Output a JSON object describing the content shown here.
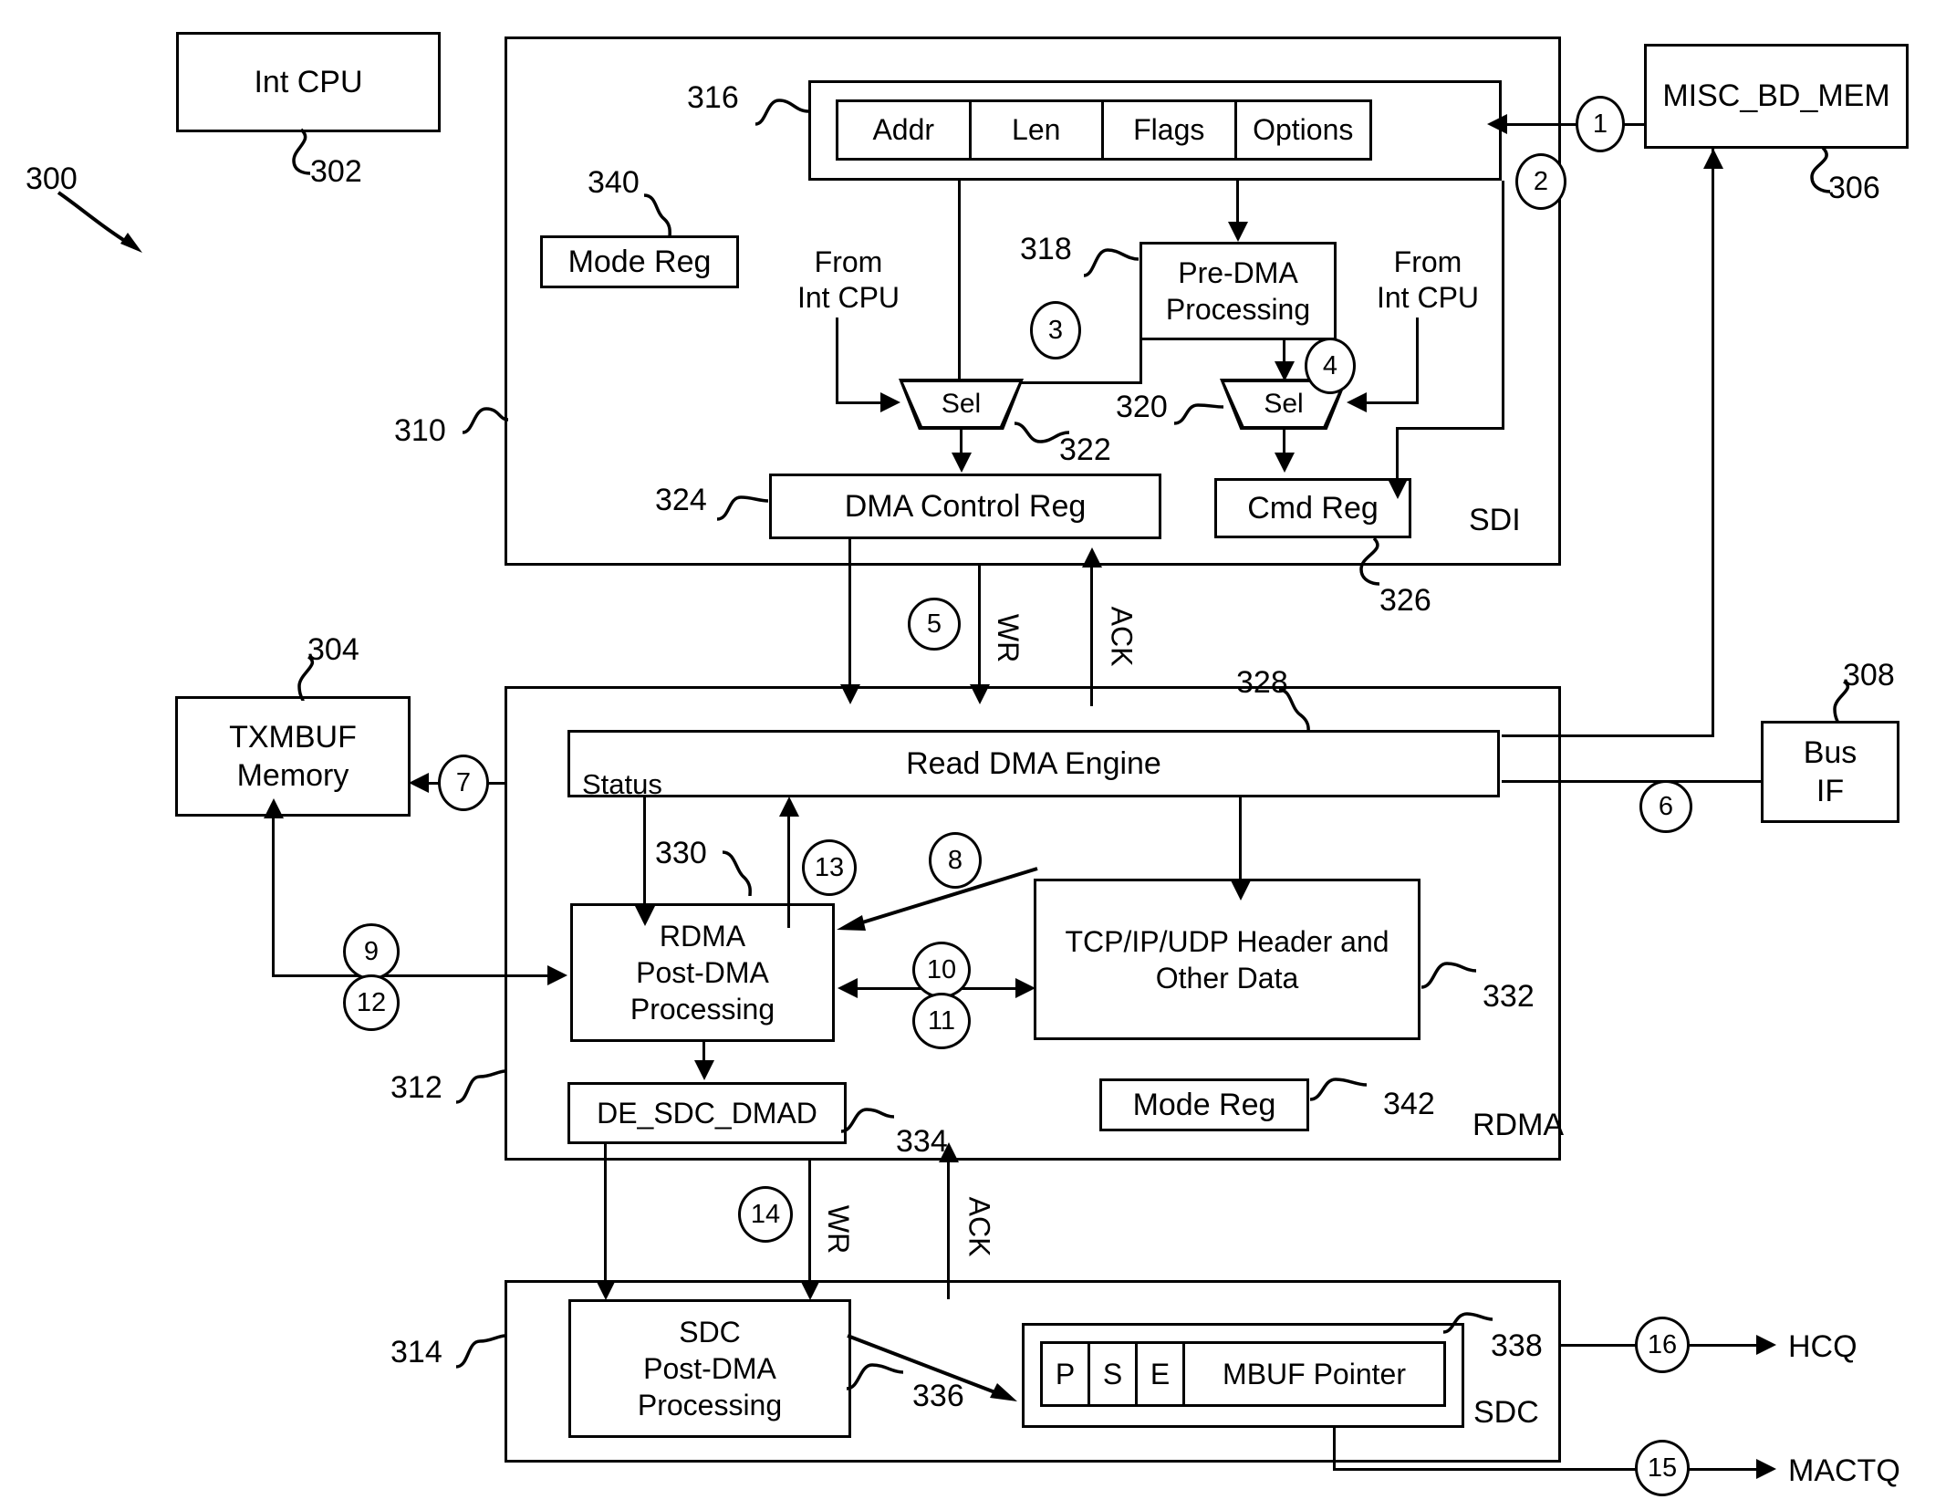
{
  "figure": {
    "number": "300"
  },
  "blocks": {
    "int_cpu": "Int CPU",
    "misc_bd_mem": "MISC_BD_MEM",
    "txmbuf_memory": "TXMBUF\nMemory",
    "txmbuf_line1": "TXMBUF",
    "txmbuf_line2": "Memory",
    "bus_if_line1": "Bus",
    "bus_if_line2": "IF",
    "mode_reg_sdi": "Mode Reg",
    "mode_reg_rdma": "Mode Reg",
    "pre_dma_line1": "Pre-DMA",
    "pre_dma_line2": "Processing",
    "dma_control_reg": "DMA Control Reg",
    "cmd_reg": "Cmd Reg",
    "sel_left": "Sel",
    "sel_right": "Sel",
    "read_dma_engine": "Read DMA Engine",
    "status": "Status",
    "rdma_post_dma_l1": "RDMA",
    "rdma_post_dma_l2": "Post-DMA",
    "rdma_post_dma_l3": "Processing",
    "tcp_header_l1": "TCP/IP/UDP Header and",
    "tcp_header_l2": "Other Data",
    "de_sdc_dmad": "DE_SDC_DMAD",
    "sdc_post_dma_l1": "SDC",
    "sdc_post_dma_l2": "Post-DMA",
    "sdc_post_dma_l3": "Processing",
    "mbuf_pointer": "MBUF Pointer",
    "mbuf_p": "P",
    "mbuf_s": "S",
    "mbuf_e": "E"
  },
  "bd_fields": [
    "Addr",
    "Len",
    "Flags",
    "Options"
  ],
  "container_labels": {
    "sdi": "SDI",
    "rdma": "RDMA",
    "sdc": "SDC"
  },
  "from_labels": {
    "from_int_cpu_left_l1": "From",
    "from_int_cpu_left_l2": "Int CPU",
    "from_int_cpu_right_l1": "From",
    "from_int_cpu_right_l2": "Int CPU"
  },
  "signal_labels": {
    "wr_top": "WR",
    "ack_top": "ACK",
    "wr_bottom": "WR",
    "ack_bottom": "ACK"
  },
  "outputs": {
    "hcq": "HCQ",
    "mactq": "MACTQ"
  },
  "reference_numerals": {
    "n300": "300",
    "n302": "302",
    "n304": "304",
    "n306": "306",
    "n308": "308",
    "n310": "310",
    "n312": "312",
    "n314": "314",
    "n316": "316",
    "n318": "318",
    "n320": "320",
    "n322": "322",
    "n324": "324",
    "n326": "326",
    "n328": "328",
    "n330": "330",
    "n332": "332",
    "n334": "334",
    "n336": "336",
    "n338": "338",
    "n340": "340",
    "n342": "342"
  },
  "step_circles": {
    "s1": "1",
    "s2": "2",
    "s3": "3",
    "s4": "4",
    "s5": "5",
    "s6": "6",
    "s7": "7",
    "s8": "8",
    "s9": "9",
    "s10": "10",
    "s11": "11",
    "s12": "12",
    "s13": "13",
    "s14": "14",
    "s15": "15",
    "s16": "16"
  }
}
